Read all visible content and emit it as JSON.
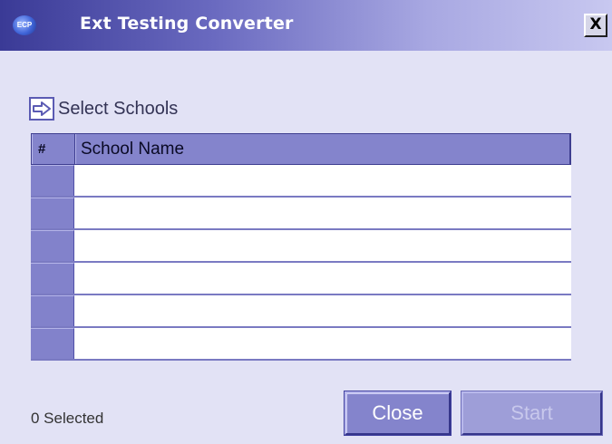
{
  "window": {
    "title": "Ext Testing Converter",
    "close_glyph": "X",
    "app_icon": "ecp-globe-icon",
    "app_icon_text": "ECP"
  },
  "section": {
    "icon": "arrow-right-icon",
    "label": "Select Schools"
  },
  "grid": {
    "columns": [
      "#",
      "School Name"
    ],
    "rows": [
      {
        "num": "",
        "name": ""
      },
      {
        "num": "",
        "name": ""
      },
      {
        "num": "",
        "name": ""
      },
      {
        "num": "",
        "name": ""
      },
      {
        "num": "",
        "name": ""
      },
      {
        "num": "",
        "name": ""
      }
    ]
  },
  "footer": {
    "status": "0 Selected",
    "close_label": "Close",
    "start_label": "Start",
    "start_enabled": false
  },
  "colors": {
    "background": "#e2e2f5",
    "accent": "#8484cc",
    "title_gradient_start": "#3a3a96",
    "title_gradient_end": "#c8c8f0"
  }
}
